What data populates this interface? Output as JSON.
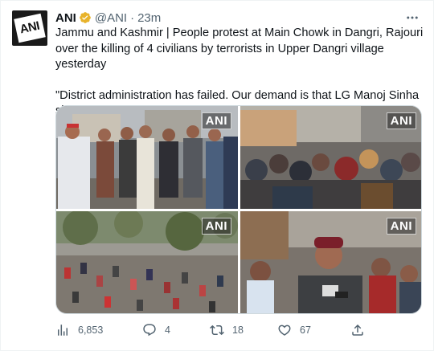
{
  "tweet": {
    "display_name": "ANI",
    "handle": "@ANI",
    "separator": "·",
    "time": "23m",
    "avatar_text": "ANI",
    "text_line1": "Jammu and Kashmir | People protest at Main Chowk in Dangri, Rajouri over the killing of 4 civilians by terrorists in Upper Dangri village yesterday",
    "text_line2": "\"District administration has failed. Our demand is that  LG Manoj Sinha should come here and listen to our demands,\" says a local",
    "watermark": "ANI",
    "colors": {
      "verified": "#e8b32b",
      "secondary_text": "#536471",
      "border": "#cfd9de"
    }
  },
  "actions": {
    "views": {
      "icon": "views-icon",
      "count": "6,853"
    },
    "reply": {
      "icon": "reply-icon",
      "count": "4"
    },
    "retweet": {
      "icon": "retweet-icon",
      "count": "18"
    },
    "like": {
      "icon": "like-icon",
      "count": "67"
    },
    "share": {
      "icon": "share-icon"
    }
  }
}
